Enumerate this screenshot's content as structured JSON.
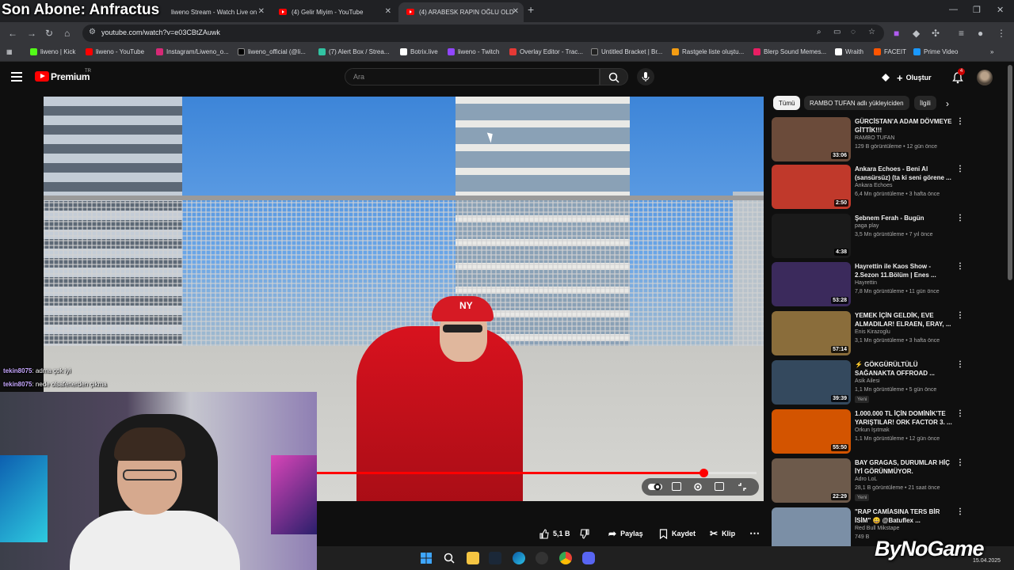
{
  "overlay": {
    "title": "Son Abone: Anfractus"
  },
  "browser": {
    "tabs": [
      {
        "label": "liweno Stream - Watch Live on"
      },
      {
        "label": "(4) Gelir Miyim - YouTube"
      },
      {
        "label": "(4) ARABESK RAPIN OĞLU OLD"
      }
    ],
    "new_tab": "+",
    "window_controls": [
      "—",
      "❐",
      "✕"
    ],
    "url": "youtube.com/watch?v=e03CBtZAuwk",
    "bookmarks": [
      {
        "label": "liweno | Kick",
        "color": "#53fc18"
      },
      {
        "label": "liweno - YouTube",
        "color": "#ff0000"
      },
      {
        "label": "Instagram/Liweno_o...",
        "color": "#d62976"
      },
      {
        "label": "liweno_official (@li...",
        "color": "#000000"
      },
      {
        "label": "(7) Alert Box / Strea...",
        "color": "#31c3a2"
      },
      {
        "label": "Botrix.live",
        "color": "#ffffff"
      },
      {
        "label": "liweno - Twitch",
        "color": "#9146ff"
      },
      {
        "label": "Overlay Editor - Trac...",
        "color": "#e53935"
      },
      {
        "label": "Untitled Bracket | Br...",
        "color": "#222222"
      },
      {
        "label": "Rastgele liste oluştu...",
        "color": "#f39c12"
      },
      {
        "label": "Blerp Sound Memes...",
        "color": "#e91e63"
      },
      {
        "label": "Wraith",
        "color": "#ffffff"
      },
      {
        "label": "FACEIT",
        "color": "#ff5500"
      },
      {
        "label": "Prime Video",
        "color": "#1a98ff"
      }
    ]
  },
  "youtube": {
    "logo_text": "Premium",
    "logo_sup": "TR",
    "search_placeholder": "Ara",
    "create_label": "Oluştur",
    "notification_count": "4",
    "actions": {
      "like_count": "5,1 B",
      "share": "Paylaş",
      "save": "Kaydet",
      "clip": "Klip"
    },
    "chips": [
      "Tümü",
      "RAMBO TUFAN adlı yükleyiciden",
      "İlgili"
    ],
    "progress": 0.88,
    "recommendations": [
      {
        "title": "GÜRCİSTAN'A ADAM DÖVMEYE GİTTİK!!!",
        "channel": "RAMBO TUFAN",
        "views": "129 B görüntüleme",
        "age": "12 gün önce",
        "duration": "33:06",
        "new": "",
        "thumb": "#6b4b3a"
      },
      {
        "title": "Ankara Echoes - Beni Al (sansürsüz) (ta ki seni görene ...",
        "channel": "Ankara Echoes",
        "views": "6,4 Mn görüntüleme",
        "age": "3 hafta önce",
        "duration": "2:50",
        "new": "",
        "thumb": "#c0392b"
      },
      {
        "title": "Şebnem Ferah - Bugün",
        "channel": "paga play",
        "views": "3,5 Mn görüntüleme",
        "age": "7 yıl önce",
        "duration": "4:38",
        "new": "",
        "thumb": "#1a1a1a"
      },
      {
        "title": "Hayrettin ile Kaos Show - 2.Sezon 11.Bölüm | Enes ...",
        "channel": "Hayrettin",
        "views": "7,8 Mn görüntüleme",
        "age": "11 gün önce",
        "duration": "53:28",
        "new": "",
        "thumb": "#3b2a5c"
      },
      {
        "title": "YEMEK İÇİN GELDİK, EVE ALMADILAR! ELRAEN, ERAY, ...",
        "channel": "Enis Kirazoglu",
        "views": "3,1 Mn görüntüleme",
        "age": "3 hafta önce",
        "duration": "57:14",
        "new": "",
        "thumb": "#8a6d3b"
      },
      {
        "title": "⚡ GÖKGÜRÜLTÜLÜ SAĞANAKTA OFFROAD ...",
        "channel": "Asik Ailesi",
        "views": "1,1 Mn görüntüleme",
        "age": "5 gün önce",
        "duration": "39:39",
        "new": "Yeni",
        "thumb": "#34495e"
      },
      {
        "title": "1.000.000 TL İÇİN DOMİNİK'TE YARIŞTILAR! ORK FACTOR 3. ...",
        "channel": "Orkun Işıtmak",
        "views": "1,1 Mn görüntüleme",
        "age": "12 gün önce",
        "duration": "55:50",
        "new": "",
        "thumb": "#d35400"
      },
      {
        "title": "BAY GRAGAS, DURUMLAR HİÇ İYİ GÖRÜNMÜYOR.",
        "channel": "Adro LoL",
        "views": "28,1 B görüntüleme",
        "age": "21 saat önce",
        "duration": "22:29",
        "new": "Yeni",
        "thumb": "#6d5a4b"
      },
      {
        "title": "\"RAP CAMİASINA TERS BİR İSİM\" 😀 @Batuflex ...",
        "channel": "Red Bull Mikstape",
        "views": "749 B",
        "age": "",
        "duration": "",
        "new": "",
        "thumb": "#7b8fa6"
      }
    ]
  },
  "chat": [
    {
      "user": "tekin8075",
      "message": ": adma çok iyi"
    },
    {
      "user": "tekin8075",
      "message": ": nede olsafenerden çıkma"
    }
  ],
  "watermark": "ByNoGame",
  "datetime": "15.04.2025"
}
